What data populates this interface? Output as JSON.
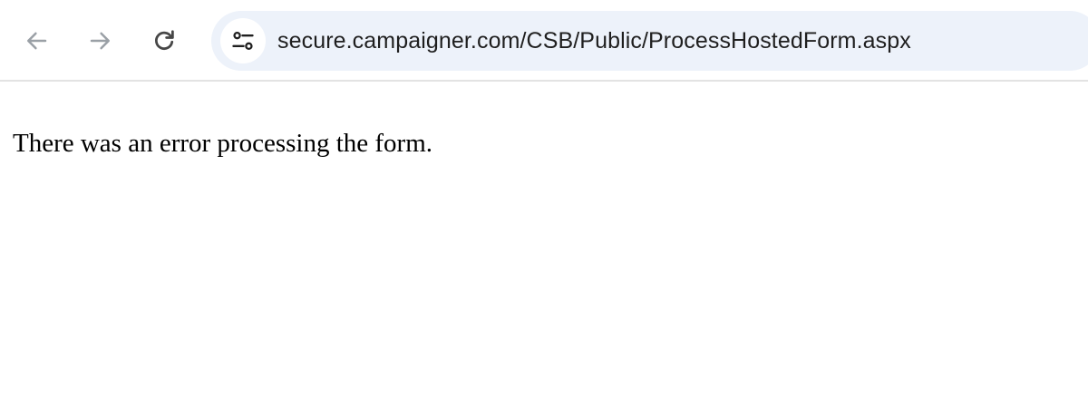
{
  "browser": {
    "back_icon": "arrow-left-icon",
    "forward_icon": "arrow-right-icon",
    "reload_icon": "reload-icon",
    "site_info_icon": "tune-icon",
    "url": "secure.campaigner.com/CSB/Public/ProcessHostedForm.aspx",
    "colors": {
      "omnibox_bg": "#edf2fa",
      "nav_icon_disabled": "#9aa0a6",
      "nav_icon_active": "#474747"
    }
  },
  "page": {
    "message": "There was an error processing the form."
  }
}
